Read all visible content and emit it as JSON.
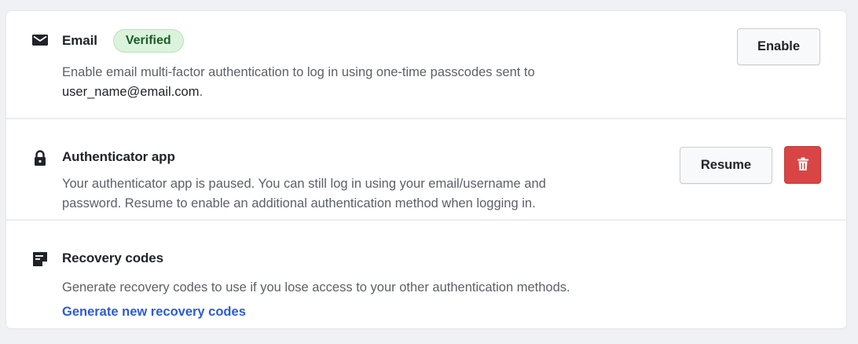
{
  "methods": {
    "email": {
      "icon": "envelope-icon",
      "title": "Email",
      "badge": "Verified",
      "description": "Enable email multi-factor authentication to log in using one-time passcodes sent to",
      "address": "user_name@email.com",
      "address_suffix": ".",
      "button_label": "Enable"
    },
    "authenticator": {
      "icon": "lock-icon",
      "title": "Authenticator app",
      "description_line1": "Your authenticator app is paused. You can still log in using your email/username and",
      "description_line2": "password. Resume to enable an additional authentication method when logging in.",
      "button_label": "Resume",
      "delete_icon": "trash-icon"
    },
    "recovery": {
      "icon": "sticky-note-icon",
      "title": "Recovery codes",
      "description": "Generate recovery codes to use if you lose access to your other authentication methods.",
      "link_label": "Generate new recovery codes"
    }
  },
  "colors": {
    "background": "#f0f1f4",
    "card": "#ffffff",
    "badge_bg": "#dbf3dc",
    "badge_text": "#1c5d26",
    "danger": "#d94545",
    "link": "#2b5bd7",
    "muted_text": "#5c6068"
  }
}
